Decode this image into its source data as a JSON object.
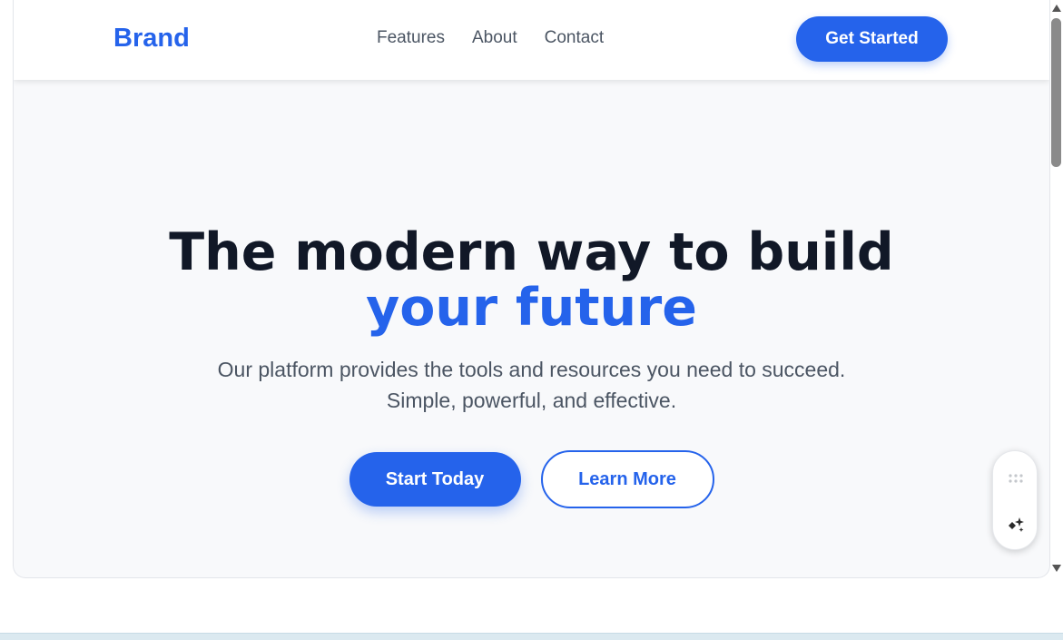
{
  "navbar": {
    "brand": "Brand",
    "links": [
      "Features",
      "About",
      "Contact"
    ],
    "cta_label": "Get Started"
  },
  "hero": {
    "title_line1": "The modern way to build",
    "title_line2": "your future",
    "subtitle_line1": "Our platform provides the tools and resources you need to succeed.",
    "subtitle_line2": "Simple, powerful, and effective.",
    "primary_button": "Start Today",
    "secondary_button": "Learn More"
  },
  "widget": {
    "icons": [
      "drag-handle-icon",
      "sparkle-icon"
    ]
  },
  "colors": {
    "accent": "#2563eb",
    "heading": "#111827",
    "body_text": "#4b5563",
    "hero_background": "#f8f9fb"
  }
}
